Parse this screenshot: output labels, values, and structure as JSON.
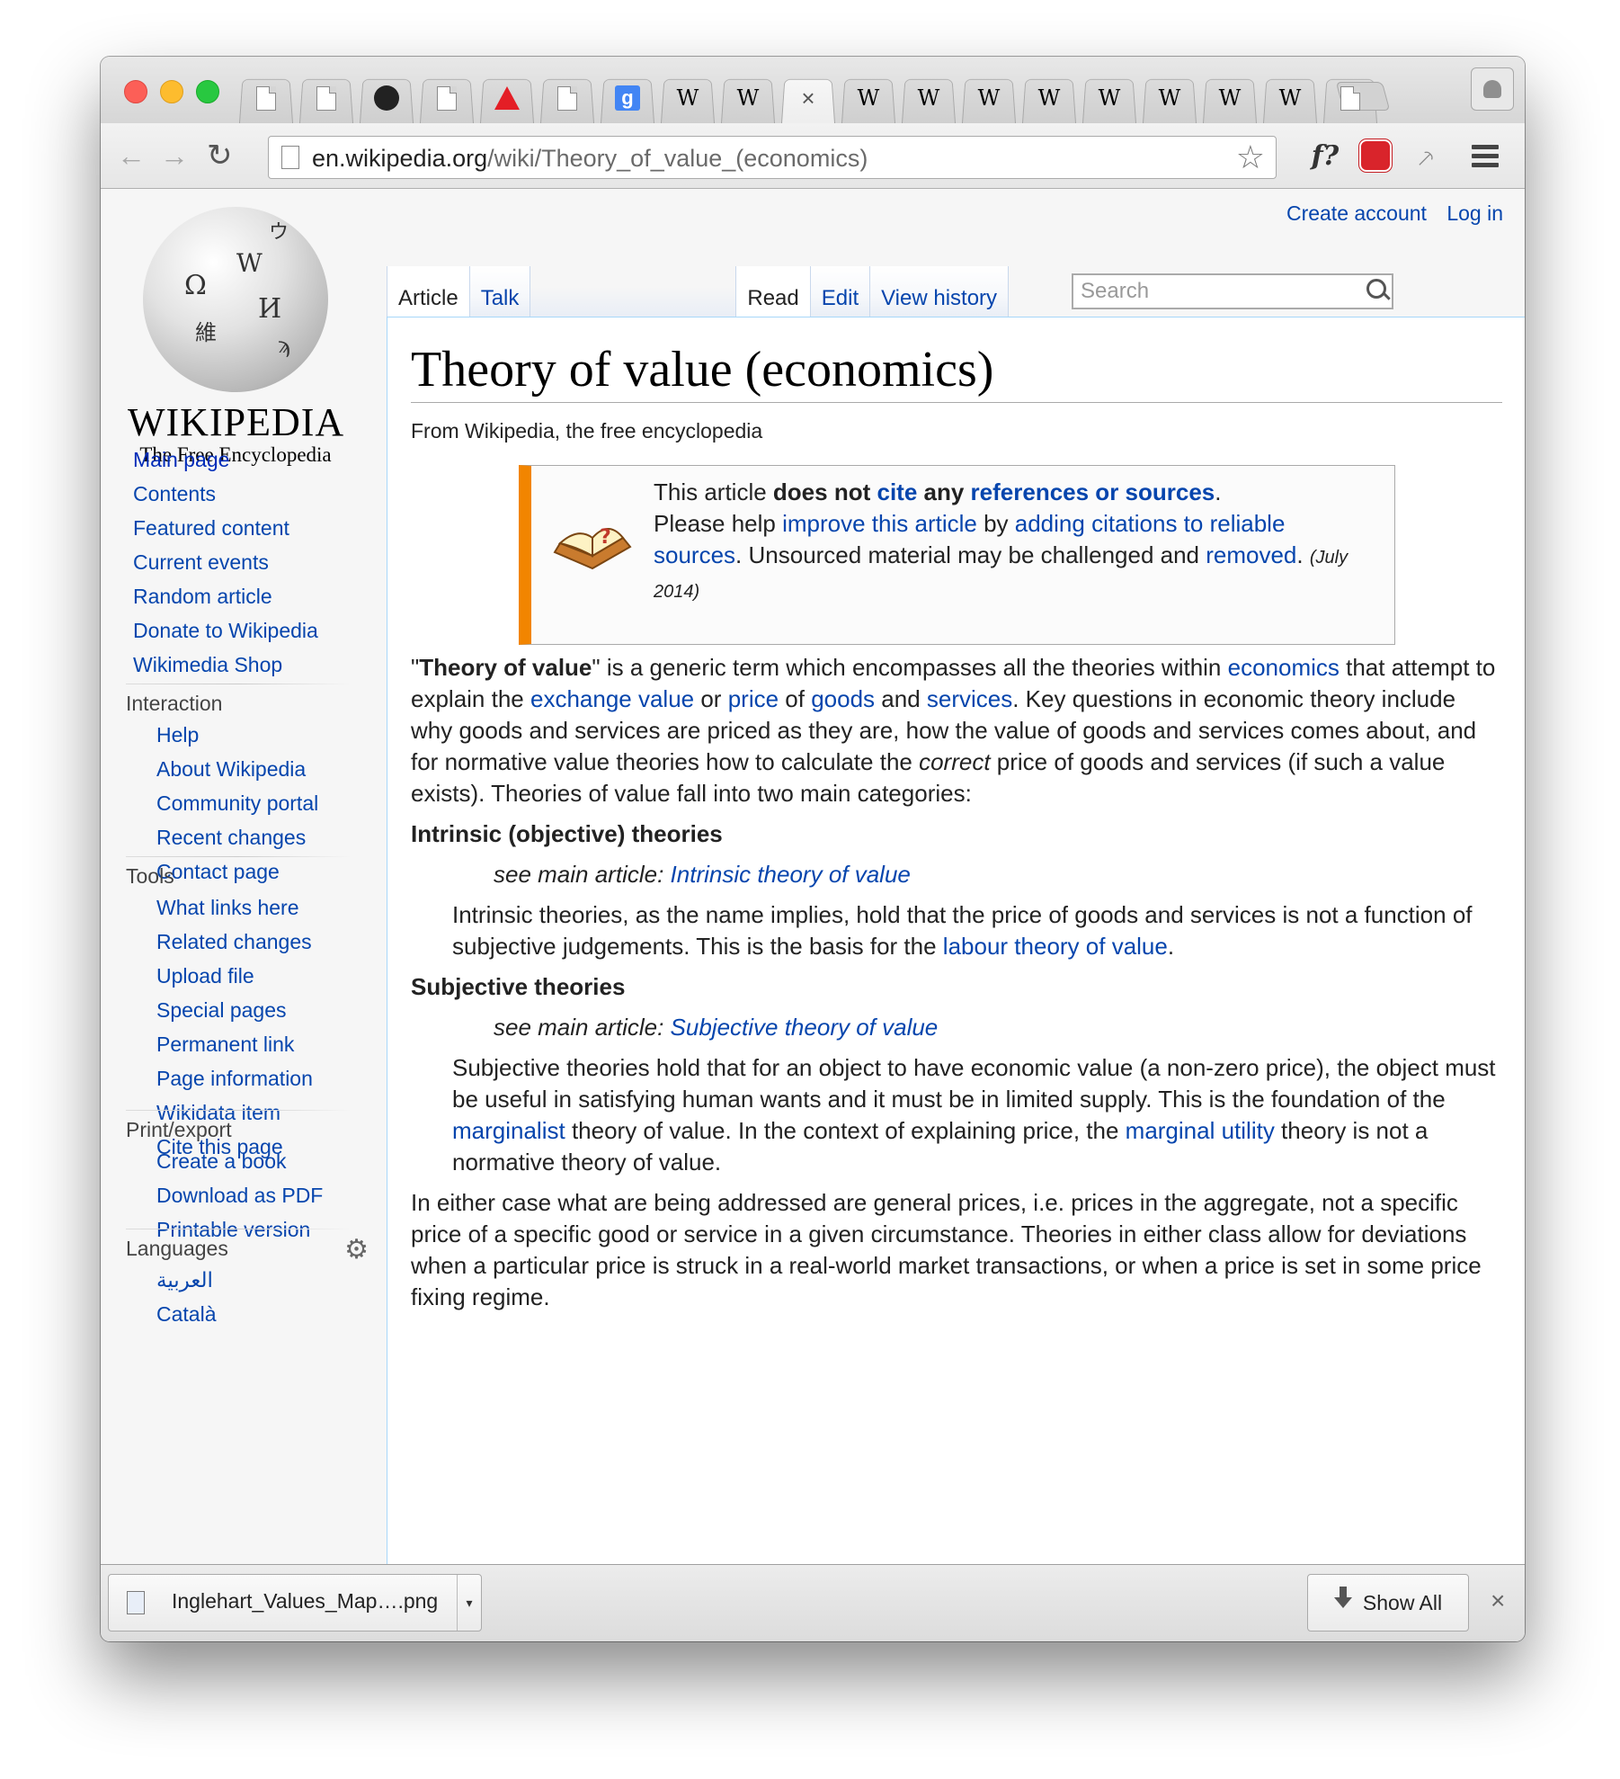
{
  "browser": {
    "tabs": [
      {
        "icon": "page-icon"
      },
      {
        "icon": "page-icon"
      },
      {
        "icon": "github-icon"
      },
      {
        "icon": "page-icon"
      },
      {
        "icon": "adobe-icon"
      },
      {
        "icon": "page-icon"
      },
      {
        "icon": "google-icon",
        "glyph": "g"
      },
      {
        "icon": "wikipedia-icon",
        "glyph": "W"
      },
      {
        "icon": "wikipedia-icon",
        "glyph": "W"
      },
      {
        "icon": "close-icon",
        "glyph": "×",
        "active": true
      },
      {
        "icon": "wikipedia-icon",
        "glyph": "W"
      },
      {
        "icon": "wikipedia-icon",
        "glyph": "W"
      },
      {
        "icon": "wikipedia-icon",
        "glyph": "W"
      },
      {
        "icon": "wikipedia-icon",
        "glyph": "W"
      },
      {
        "icon": "wikipedia-icon",
        "glyph": "W"
      },
      {
        "icon": "wikipedia-icon",
        "glyph": "W"
      },
      {
        "icon": "wikipedia-icon",
        "glyph": "W"
      },
      {
        "icon": "wikipedia-icon",
        "glyph": "W"
      },
      {
        "icon": "page-icon"
      }
    ],
    "url_host": "en.wikipedia.org",
    "url_path": "/wiki/Theory_of_value_(economics)",
    "ext_f_label": "f?",
    "back_glyph": "←",
    "forward_glyph": "→",
    "reload_glyph": "↻",
    "star_glyph": "☆",
    "pick_glyph": "⸕"
  },
  "wiki": {
    "wordmark": "WIKIPEDIA",
    "tagline": "The Free Encyclopedia",
    "top_links": {
      "create_account": "Create account",
      "log_in": "Log in"
    },
    "tabs": {
      "article": "Article",
      "talk": "Talk",
      "read": "Read",
      "edit": "Edit",
      "history": "View history"
    },
    "search_placeholder": "Search",
    "nav_main": [
      "Main page",
      "Contents",
      "Featured content",
      "Current events",
      "Random article",
      "Donate to Wikipedia",
      "Wikimedia Shop"
    ],
    "interaction": {
      "heading": "Interaction",
      "items": [
        "Help",
        "About Wikipedia",
        "Community portal",
        "Recent changes",
        "Contact page"
      ]
    },
    "tools": {
      "heading": "Tools",
      "items": [
        "What links here",
        "Related changes",
        "Upload file",
        "Special pages",
        "Permanent link",
        "Page information",
        "Wikidata item",
        "Cite this page"
      ]
    },
    "print": {
      "heading": "Print/export",
      "items": [
        "Create a book",
        "Download as PDF",
        "Printable version"
      ]
    },
    "languages": {
      "heading": "Languages",
      "items": [
        "العربية",
        "Català"
      ]
    }
  },
  "article": {
    "title": "Theory of value (economics)",
    "from": "From Wikipedia, the free encyclopedia",
    "ambox": {
      "t1": "This article ",
      "t2": "does not ",
      "t3": "cite",
      "t4": " any ",
      "t5": "references or sources",
      "t6": ".",
      "t7": "Please help ",
      "t8": "improve this article",
      "t9": " by ",
      "t10": "adding citations to reliable sources",
      "t11": ". Unsourced material may be challenged and ",
      "t12": "removed",
      "t13": ".",
      "date": "(July 2014)"
    },
    "p1": {
      "q1": "\"",
      "bold": "Theory of value",
      "q2": "\" is a generic term which encompasses all the theories within ",
      "l1": "economics",
      "t1": " that attempt to explain the ",
      "l2": "exchange value",
      "t2": " or ",
      "l3": "price",
      "t3": " of ",
      "l4": "goods",
      "t4": " and ",
      "l5": "services",
      "t5": ". Key questions in economic theory include why goods and services are priced as they are, how the value of goods and services comes about, and for normative value theories how to calculate the ",
      "em": "correct",
      "t6": " price of goods and services (if such a value exists). Theories of value fall into two main categories:"
    },
    "h_intrinsic": "Intrinsic (objective) theories",
    "see1_prefix": "see main article: ",
    "see1_link": "Intrinsic theory of value",
    "intrinsic_text": "Intrinsic theories, as the name implies, hold that the price of goods and services is not a function of subjective judgements. This is the basis for the ",
    "intrinsic_link": "labour theory of value",
    "intrinsic_end": ".",
    "h_subjective": "Subjective theories",
    "see2_prefix": "see main article: ",
    "see2_link": "Subjective theory of value",
    "subj_t1": "Subjective theories hold that for an object to have economic value (a non-zero price), the object must be useful in satisfying human wants and it must be in limited supply. This is the foundation of the ",
    "subj_l1": "marginalist",
    "subj_t2": " theory of value. In the context of explaining price, the ",
    "subj_l2": "marginal utility",
    "subj_t3": " theory is not a normative theory of value.",
    "p_last": "In either case what are being addressed are general prices, i.e. prices in the aggregate, not a specific price of a specific good or service in a given circumstance. Theories in either class allow for deviations when a particular price is struck in a real-world market transactions, or when a price is set in some price fixing regime."
  },
  "downloads": {
    "file_name": "Inglehart_Values_Map….png",
    "caret": "▾",
    "show_all": "Show All",
    "close": "×"
  }
}
